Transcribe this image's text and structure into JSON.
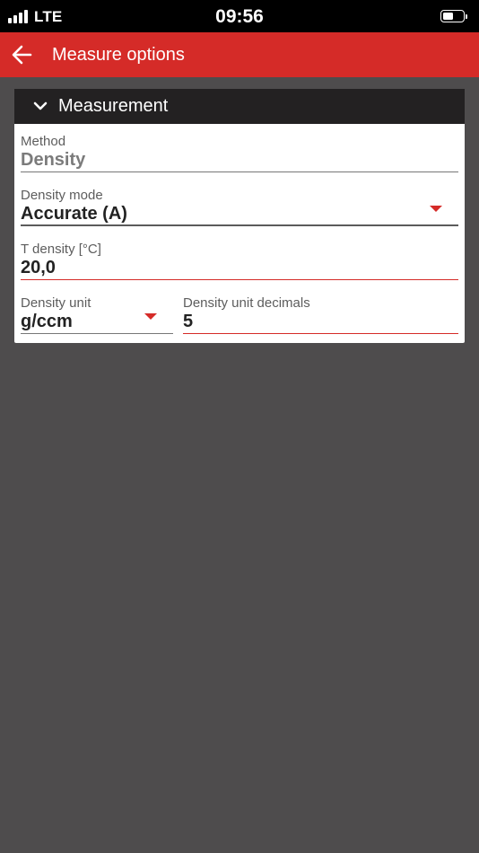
{
  "status_bar": {
    "network": "LTE",
    "time": "09:56",
    "signal_bars": 4,
    "battery_level": 0.45
  },
  "app_bar": {
    "back_icon": "arrow-left-icon",
    "title": "Measure options",
    "color": "#d52b28"
  },
  "section": {
    "icon": "chevron-down-icon",
    "title": "Measurement",
    "expanded": true
  },
  "fields": {
    "method": {
      "label": "Method",
      "value": "Density",
      "editable": false
    },
    "density_mode": {
      "label": "Density mode",
      "value": "Accurate (A)"
    },
    "t_density": {
      "label": "T density [°C]",
      "value": "20,0"
    },
    "density_unit": {
      "label": "Density unit",
      "value": "g/ccm"
    },
    "density_unit_decimals": {
      "label": "Density unit decimals",
      "value": "5"
    }
  }
}
